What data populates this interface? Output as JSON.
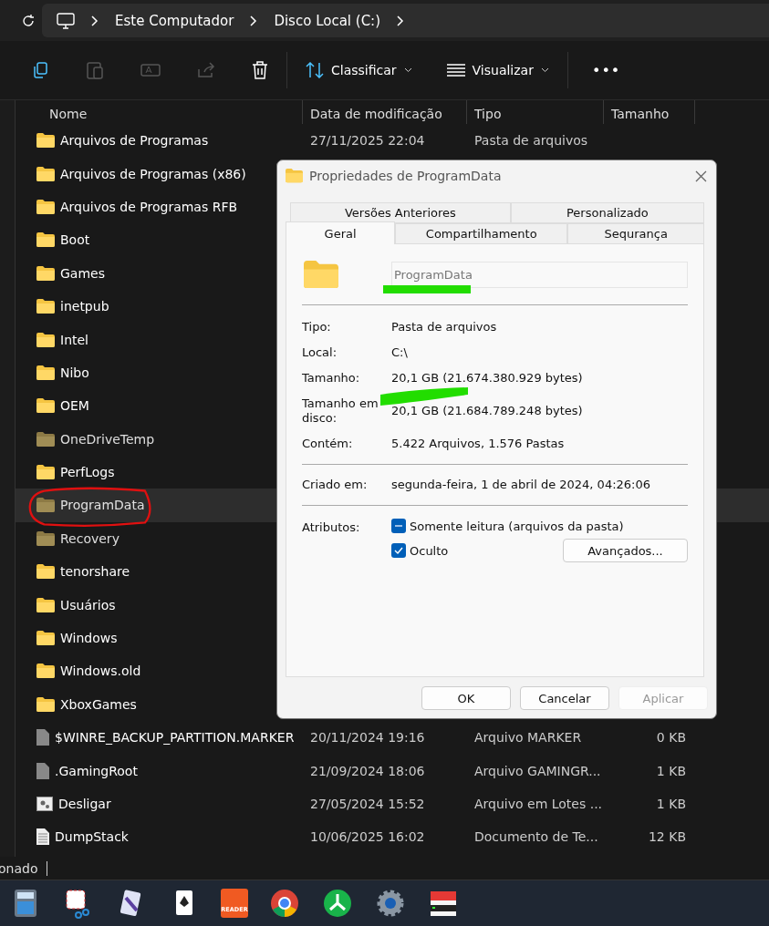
{
  "breadcrumb": [
    "Este Computador",
    "Disco Local (C:)"
  ],
  "toolbar": {
    "sort": "Classificar",
    "view": "Visualizar",
    "more": "•••"
  },
  "columns": [
    "Nome",
    "Data de modificação",
    "Tipo",
    "Tamanho"
  ],
  "rows": [
    {
      "kind": "folder",
      "name": "Arquivos de Programas",
      "date": "27/11/2025 22:04",
      "type": "Pasta de arquivos",
      "hidden": false,
      "selected": false
    },
    {
      "kind": "folder",
      "name": "Arquivos de Programas (x86)",
      "hidden": false,
      "selected": false
    },
    {
      "kind": "folder",
      "name": "Arquivos de Programas RFB",
      "hidden": false,
      "selected": false
    },
    {
      "kind": "folder",
      "name": "Boot",
      "hidden": false,
      "selected": false
    },
    {
      "kind": "folder",
      "name": "Games",
      "hidden": false,
      "selected": false
    },
    {
      "kind": "folder",
      "name": "inetpub",
      "hidden": false,
      "selected": false
    },
    {
      "kind": "folder",
      "name": "Intel",
      "hidden": false,
      "selected": false
    },
    {
      "kind": "folder",
      "name": "Nibo",
      "hidden": false,
      "selected": false
    },
    {
      "kind": "folder",
      "name": "OEM",
      "hidden": false,
      "selected": false
    },
    {
      "kind": "folder",
      "name": "OneDriveTemp",
      "hidden": true,
      "selected": false
    },
    {
      "kind": "folder",
      "name": "PerfLogs",
      "hidden": false,
      "selected": false
    },
    {
      "kind": "folder",
      "name": "ProgramData",
      "hidden": true,
      "selected": true
    },
    {
      "kind": "folder",
      "name": "Recovery",
      "hidden": true,
      "selected": false
    },
    {
      "kind": "folder",
      "name": "tenorshare",
      "hidden": false,
      "selected": false
    },
    {
      "kind": "folder",
      "name": "Usuários",
      "hidden": false,
      "selected": false
    },
    {
      "kind": "folder",
      "name": "Windows",
      "hidden": false,
      "selected": false
    },
    {
      "kind": "folder",
      "name": "Windows.old",
      "hidden": false,
      "selected": false
    },
    {
      "kind": "folder",
      "name": "XboxGames",
      "hidden": false,
      "selected": false
    },
    {
      "kind": "file",
      "name": "$WINRE_BACKUP_PARTITION.MARKER",
      "date": "20/11/2024 19:16",
      "type": "Arquivo MARKER",
      "size": "0 KB",
      "hidden": false,
      "selected": false
    },
    {
      "kind": "file",
      "name": ".GamingRoot",
      "date": "21/09/2024 18:06",
      "type": "Arquivo GAMINGR...",
      "size": "1 KB",
      "hidden": false,
      "selected": false
    },
    {
      "kind": "batch",
      "name": "Desligar",
      "date": "27/05/2024 15:52",
      "type": "Arquivo em Lotes ...",
      "size": "1 KB",
      "hidden": false,
      "selected": false
    },
    {
      "kind": "text",
      "name": "DumpStack",
      "date": "10/06/2025 16:02",
      "type": "Documento de Te...",
      "size": "12 KB",
      "hidden": false,
      "selected": false
    }
  ],
  "status": "onado",
  "dialog": {
    "title": "Propriedades de ProgramData",
    "tabs": [
      [
        {
          "label": "Versões Anteriores",
          "selected": false
        },
        {
          "label": "Personalizado",
          "selected": false
        }
      ],
      [
        {
          "label": "Geral",
          "selected": true
        },
        {
          "label": "Compartilhamento",
          "selected": false
        },
        {
          "label": "Sequrança",
          "selected": false
        }
      ]
    ],
    "name": "ProgramData",
    "info": [
      {
        "label": "Tipo:",
        "value": "Pasta de arquivos"
      },
      {
        "label": "Local:",
        "value": "C:\\"
      },
      {
        "label": "Tamanho:",
        "value": "20,1 GB (21.674.380.929 bytes)"
      },
      {
        "label": "Tamanho em disco:",
        "value": "20,1 GB (21.684.789.248 bytes)"
      },
      {
        "label": "Contém:",
        "value": "5.422 Arquivos, 1.576 Pastas"
      }
    ],
    "created": {
      "label": "Criado em:",
      "value": "segunda-feira, 1 de abril de 2024, 04:26:06"
    },
    "attributes_label": "Atributos:",
    "attributes": [
      {
        "kind": "partial",
        "label": "Somente leitura (arquivos da pasta)",
        "checked": true
      },
      {
        "kind": "full",
        "label": "Oculto",
        "checked": true
      }
    ],
    "advanced": "Avançados...",
    "buttons": [
      {
        "label": "OK",
        "disabled": false
      },
      {
        "label": "Cancelar",
        "disabled": false
      },
      {
        "label": "Aplicar",
        "disabled": true
      }
    ]
  },
  "taskbar": [
    {
      "kind": "calculator"
    },
    {
      "kind": "snipping"
    },
    {
      "kind": "cards"
    },
    {
      "kind": "solitaire"
    },
    {
      "kind": "reader",
      "label": "READER"
    },
    {
      "kind": "chrome"
    },
    {
      "kind": "tree"
    },
    {
      "kind": "gear"
    },
    {
      "kind": "drive"
    }
  ]
}
